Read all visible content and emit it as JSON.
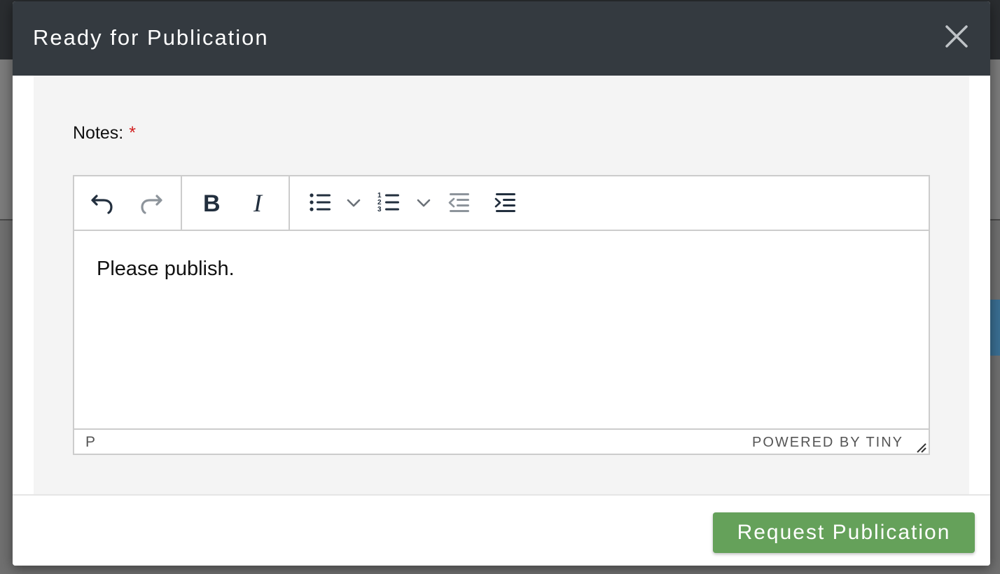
{
  "modal": {
    "title": "Ready for Publication"
  },
  "form": {
    "notes_label": "Notes:",
    "required_marker": "*"
  },
  "editor": {
    "toolbar": {
      "undo": "undo-icon",
      "redo": "redo-icon",
      "bold": "bold-icon",
      "italic": "italic-icon",
      "bullet_list": "bullet-list-icon",
      "numbered_list": "numbered-list-icon",
      "outdent": "outdent-icon",
      "indent": "indent-icon"
    },
    "content": "Please publish.",
    "element_path": "P",
    "branding": "POWERED BY TINY"
  },
  "footer": {
    "submit_label": "Request Publication"
  },
  "colors": {
    "header_bg": "#343a40",
    "submit_bg": "#65a15a",
    "required": "#d21f1f"
  }
}
